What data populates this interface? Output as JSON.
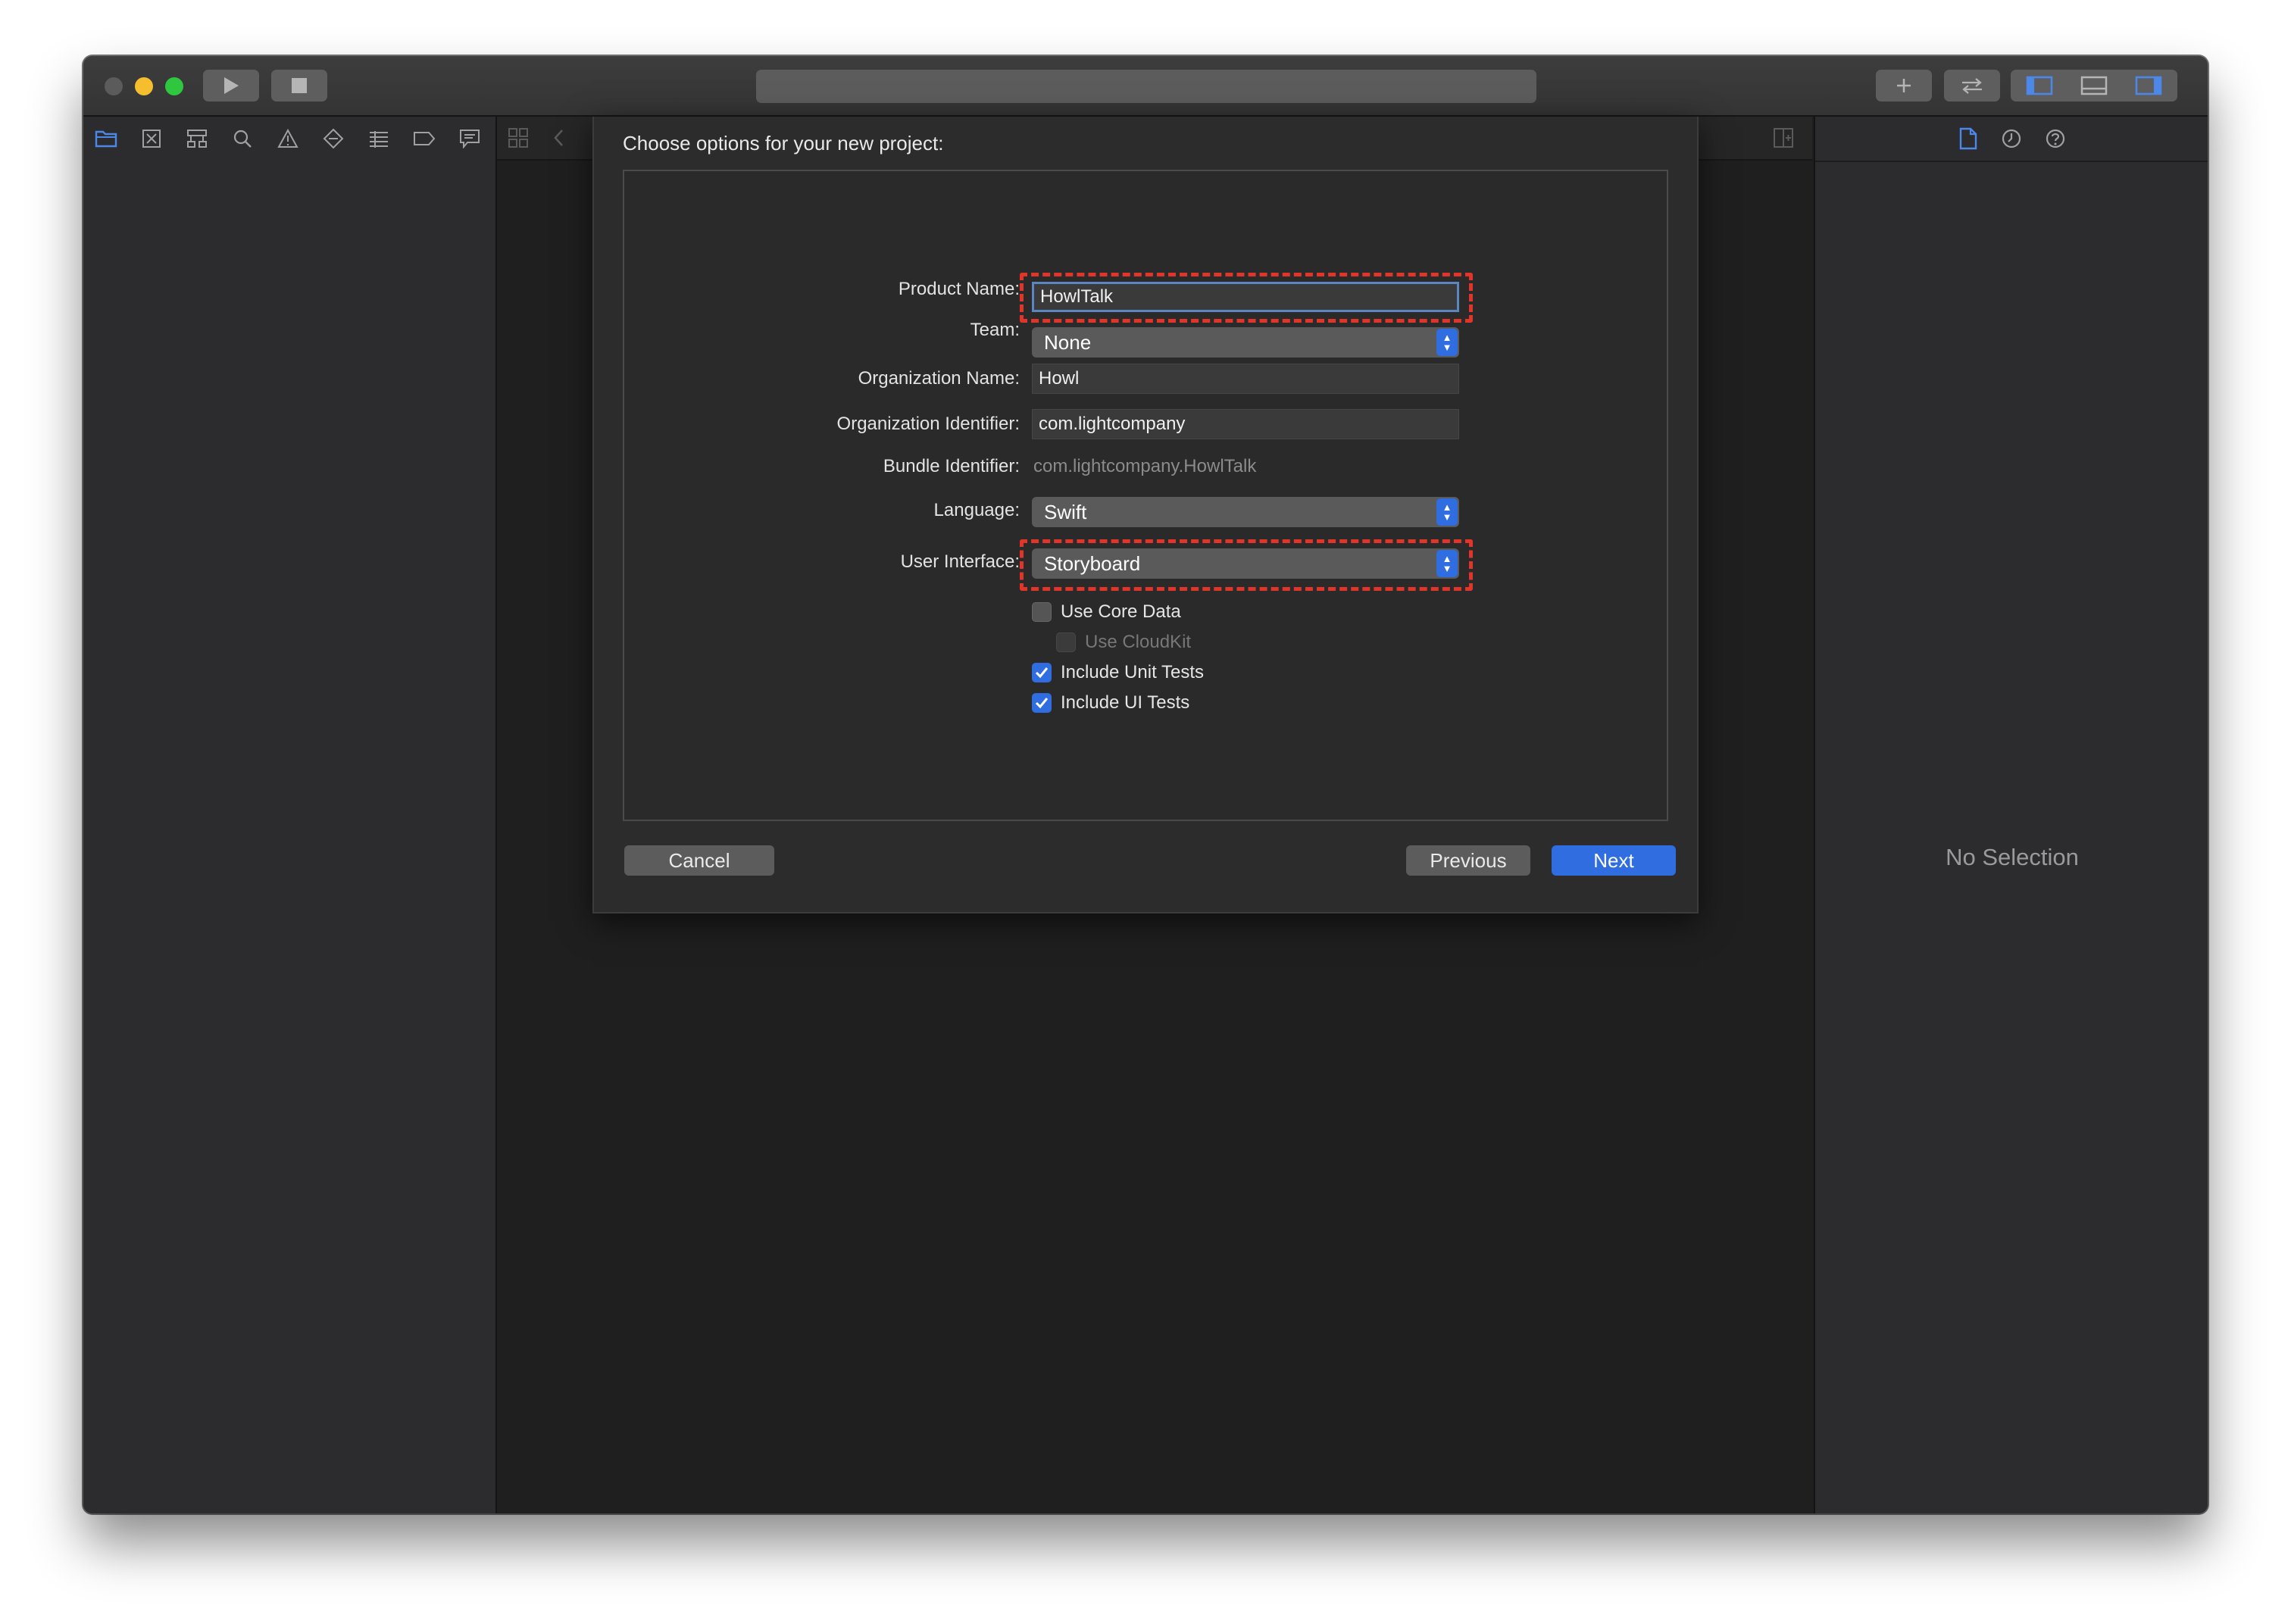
{
  "dialog": {
    "title": "Choose options for your new project:",
    "fields": {
      "product_name": {
        "label": "Product Name:",
        "value": "HowlTalk"
      },
      "team": {
        "label": "Team:",
        "value": "None"
      },
      "organization_name": {
        "label": "Organization Name:",
        "value": "Howl"
      },
      "organization_identifier": {
        "label": "Organization Identifier:",
        "value": "com.lightcompany"
      },
      "bundle_identifier": {
        "label": "Bundle Identifier:",
        "value": "com.lightcompany.HowlTalk"
      },
      "language": {
        "label": "Language:",
        "value": "Swift"
      },
      "user_interface": {
        "label": "User Interface:",
        "value": "Storyboard"
      }
    },
    "checkboxes": [
      {
        "label": "Use Core Data",
        "checked": false,
        "enabled": true
      },
      {
        "label": "Use CloudKit",
        "checked": false,
        "enabled": false
      },
      {
        "label": "Include Unit Tests",
        "checked": true,
        "enabled": true
      },
      {
        "label": "Include UI Tests",
        "checked": true,
        "enabled": true
      }
    ],
    "buttons": {
      "cancel": "Cancel",
      "previous": "Previous",
      "next": "Next"
    }
  },
  "inspector": {
    "empty_text": "No Selection"
  },
  "colors": {
    "accent": "#2f6de1",
    "highlight": "#e2352a",
    "background": "#1e1e1e"
  }
}
